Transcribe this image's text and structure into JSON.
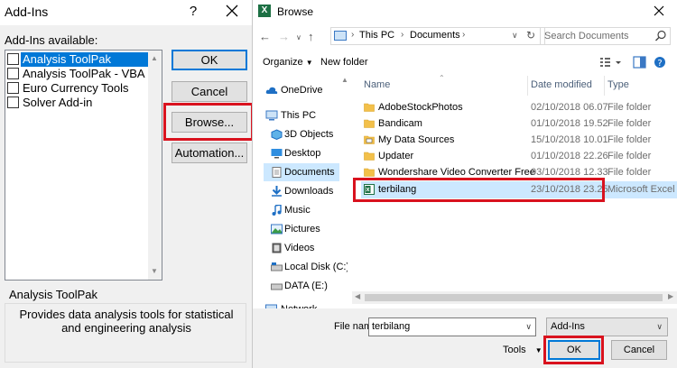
{
  "addins": {
    "title": "Add-Ins",
    "help_label": "?",
    "available_label": "Add-Ins available:",
    "items": [
      {
        "label": "Analysis ToolPak",
        "checked": false,
        "selected": true
      },
      {
        "label": "Analysis ToolPak - VBA",
        "checked": false,
        "selected": false
      },
      {
        "label": "Euro Currency Tools",
        "checked": false,
        "selected": false
      },
      {
        "label": "Solver Add-in",
        "checked": false,
        "selected": false
      }
    ],
    "buttons": {
      "ok": "OK",
      "cancel": "Cancel",
      "browse": "Browse...",
      "automation": "Automation..."
    },
    "description_title": "Analysis ToolPak",
    "description_text": "Provides data analysis tools for statistical and engineering analysis"
  },
  "browse": {
    "title": "Browse",
    "app_icon_letter": "X",
    "breadcrumb": [
      "This PC",
      "Documents"
    ],
    "search_placeholder": "Search Documents",
    "toolbar": {
      "organize": "Organize",
      "new_folder": "New folder"
    },
    "nav_items": [
      {
        "label": "OneDrive",
        "icon": "cloud-icon"
      },
      {
        "label": "This PC",
        "icon": "computer-icon"
      },
      {
        "label": "3D Objects",
        "icon": "cube-icon"
      },
      {
        "label": "Desktop",
        "icon": "desktop-icon"
      },
      {
        "label": "Documents",
        "icon": "documents-icon",
        "selected": true
      },
      {
        "label": "Downloads",
        "icon": "download-icon"
      },
      {
        "label": "Music",
        "icon": "music-icon"
      },
      {
        "label": "Pictures",
        "icon": "pictures-icon"
      },
      {
        "label": "Videos",
        "icon": "video-icon"
      },
      {
        "label": "Local Disk (C:)",
        "icon": "drive-icon"
      },
      {
        "label": "DATA (E:)",
        "icon": "drive-icon"
      },
      {
        "label": "Network",
        "icon": "network-icon"
      }
    ],
    "columns": {
      "name": "Name",
      "date": "Date modified",
      "type": "Type"
    },
    "files": [
      {
        "name": "AdobeStockPhotos",
        "date": "02/10/2018 06.07",
        "type": "File folder",
        "icon": "folder-icon"
      },
      {
        "name": "Bandicam",
        "date": "01/10/2018 19.52",
        "type": "File folder",
        "icon": "folder-icon"
      },
      {
        "name": "My Data Sources",
        "date": "15/10/2018 10.01",
        "type": "File folder",
        "icon": "data-sources-folder-icon"
      },
      {
        "name": "Updater",
        "date": "01/10/2018 22.26",
        "type": "File folder",
        "icon": "folder-icon"
      },
      {
        "name": "Wondershare Video Converter Free",
        "date": "03/10/2018 12.33",
        "type": "File folder",
        "icon": "folder-icon"
      },
      {
        "name": "terbilang",
        "date": "23/10/2018 23.25",
        "type": "Microsoft Excel A...",
        "icon": "excel-addin-icon",
        "selected": true
      }
    ],
    "file_name_label": "File name:",
    "file_name_value": "terbilang",
    "file_type_value": "Add-Ins",
    "tools_label": "Tools",
    "ok_label": "OK",
    "cancel_label": "Cancel"
  },
  "colors": {
    "highlight_red": "#d9121e",
    "selection_blue": "#0078d7",
    "explorer_selection": "#cce8ff",
    "excel_green": "#1d7044",
    "folder_yellow": "#f3c04a"
  }
}
